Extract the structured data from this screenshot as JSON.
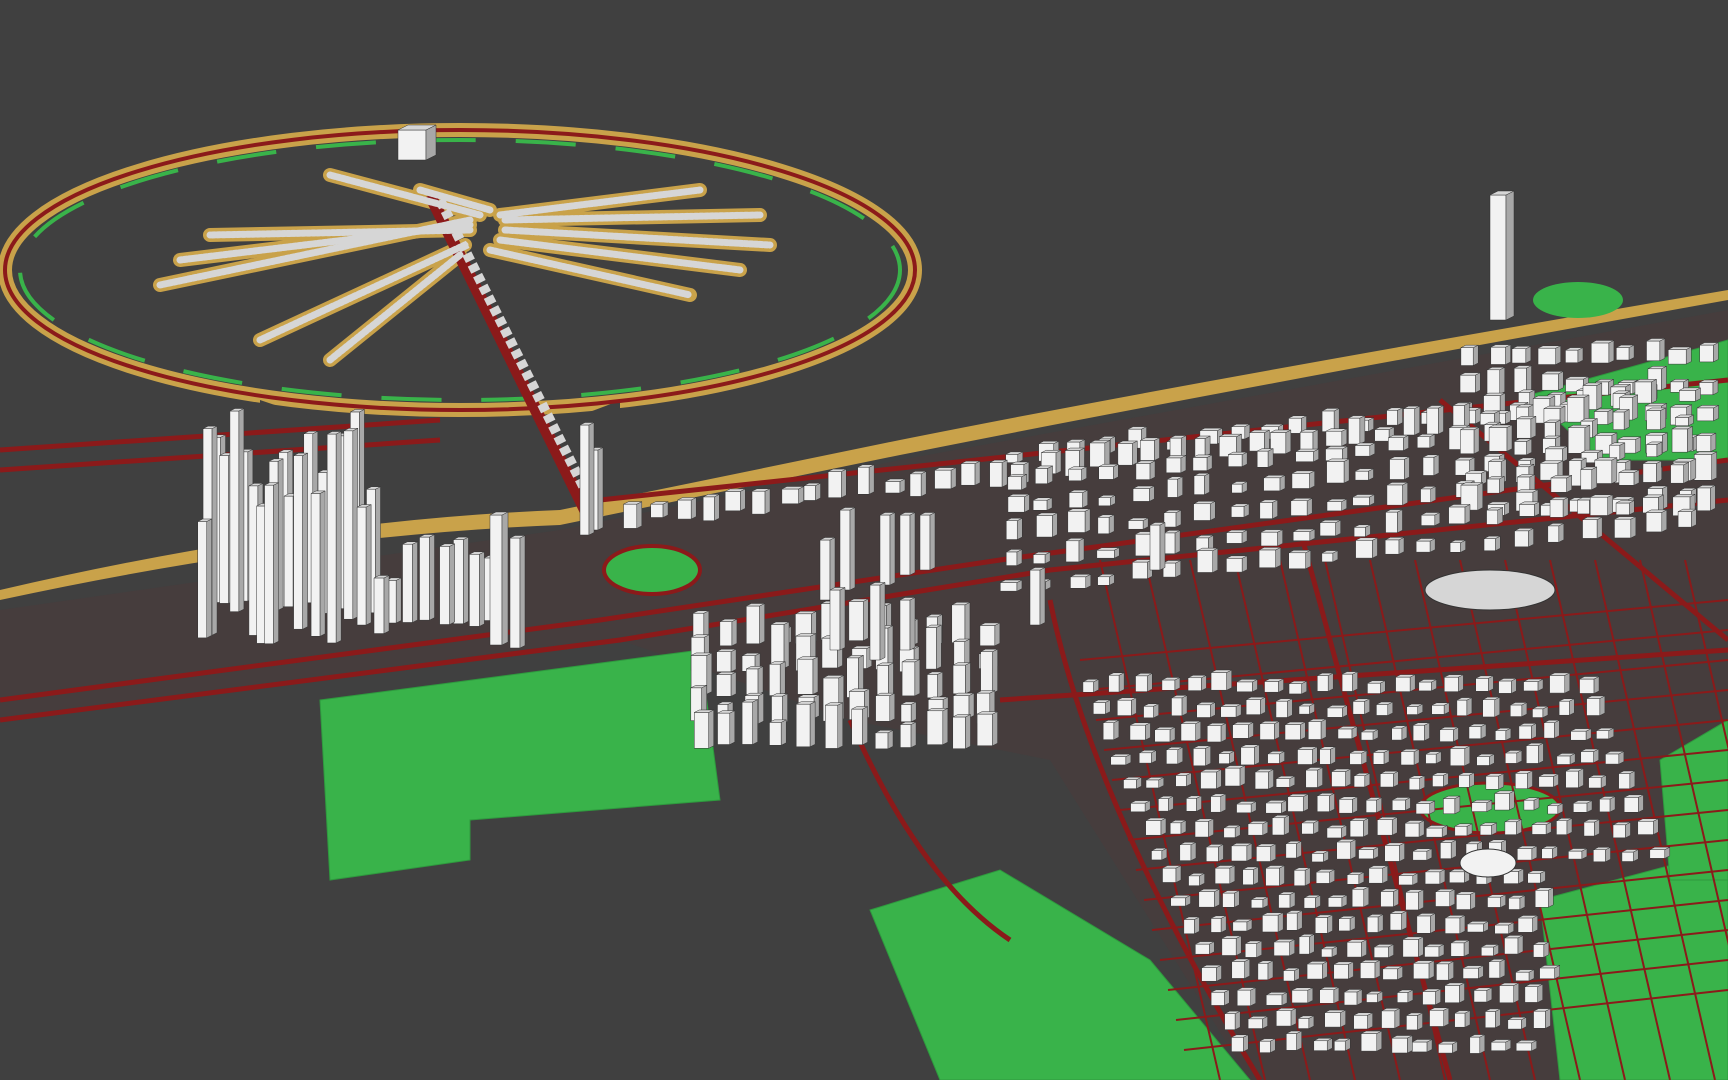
{
  "scene": {
    "description_text": "",
    "colors": {
      "background": "#404040",
      "land": "#39b34a",
      "land_dark": "#2e9a3e",
      "sand": "#c9a24a",
      "road": "#8b1a1a",
      "road_dark": "#6e1010",
      "building_light": "#f2f2f2",
      "building_mid": "#d6d6d6",
      "building_shadow": "#a8a8a8",
      "edge": "#333333"
    }
  }
}
